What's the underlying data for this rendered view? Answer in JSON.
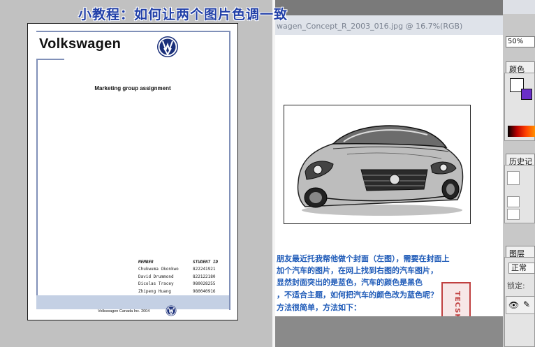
{
  "title": "小教程：如何让两个图片色调一致",
  "document": {
    "brand": "Volkswagen",
    "subtitle": "Marketing group assignment",
    "table_header": {
      "member": "MEMBER",
      "student_id": "STUDENT ID"
    },
    "members": [
      {
        "name": "Chukwuma Okonkwo",
        "id": "822241921"
      },
      {
        "name": "David  Drummond",
        "id": "822122180"
      },
      {
        "name": "Dicolas Tracey",
        "id": "980028255"
      },
      {
        "name": "Zhipeng Huang",
        "id": "980040916"
      }
    ],
    "footer": "Volkswagen Canada Inc. 2004"
  },
  "image_window": {
    "title": "wagen_Concept_R_2003_016.jpg @ 16.7%(RGB)"
  },
  "text_lines": [
    "朋友最近托我帮他做个封面（左图），需要在封面上",
    "加个汽车的图片，在网上找到右图的汽车图片，",
    "显然封面突出的是蓝色，汽车的颜色是黑色",
    "，不适合主题，如何把汽车的颜色改为蓝色呢？",
    "方法很简单，方法如下："
  ],
  "stamp_text": "TECSKU",
  "panels": {
    "zoom": "50%",
    "color_tab": "颜色",
    "history_tab": "历史记",
    "layers_tab": "图层",
    "blend_mode": "正常",
    "lock_label": "锁定:"
  },
  "colors": {
    "title": "#2240a8",
    "body_text": "#1f5bb8",
    "bg_swatch": "#6a2fc8",
    "doc_frame": "#8090b8"
  }
}
